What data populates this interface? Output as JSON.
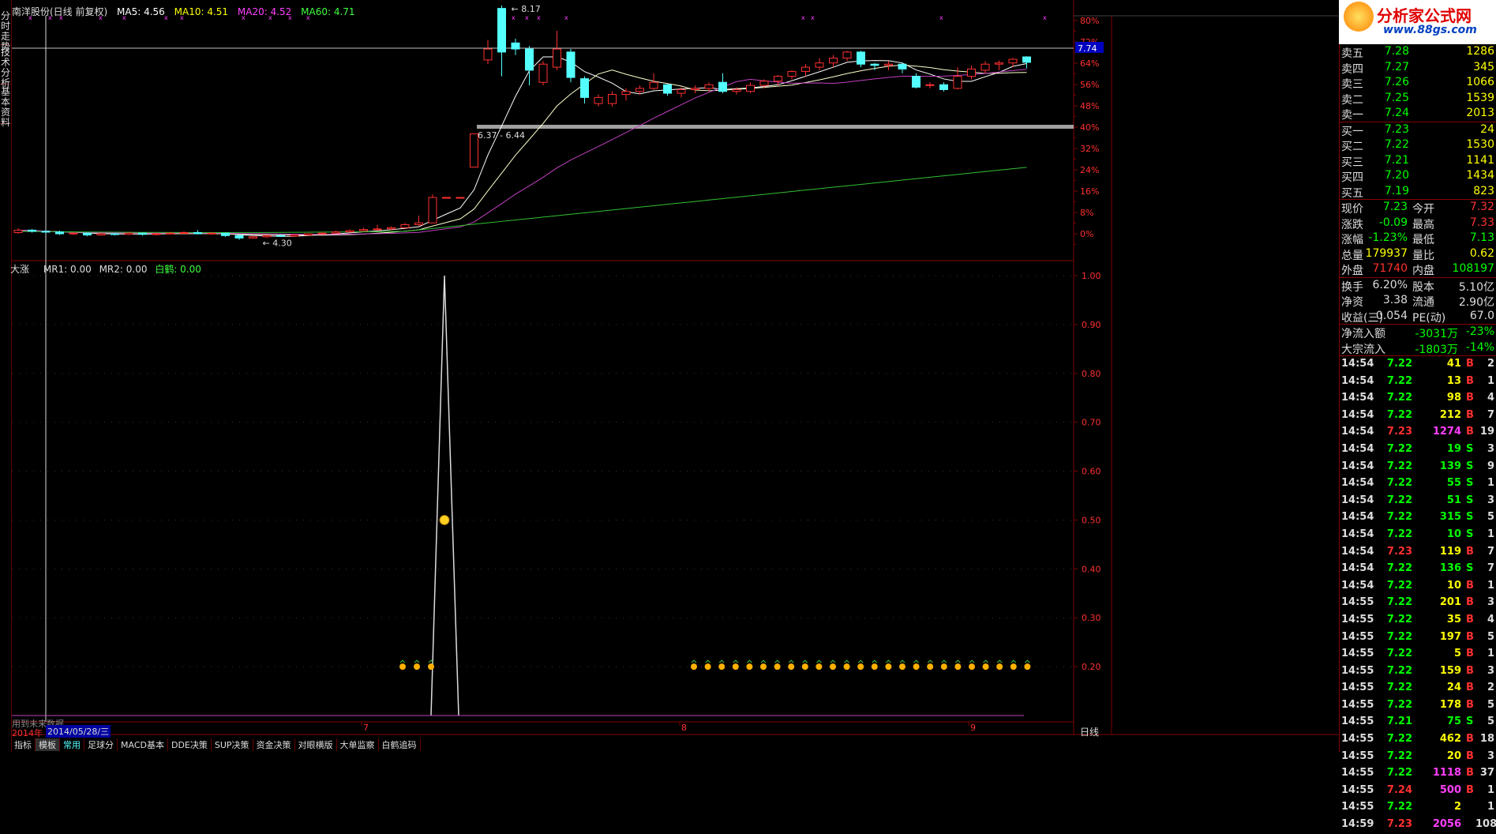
{
  "sidebar": {
    "tabs": [
      "分时走势",
      "技术分析",
      "基本资料"
    ]
  },
  "header": {
    "stock_name": "南洋股份(日线 前复权)",
    "ma5": "MA5: 4.56",
    "ma10": "MA10: 4.51",
    "ma20": "MA20: 4.52",
    "ma60": "MA60: 4.71",
    "colors": {
      "ma5": "#ffffff",
      "ma10": "#ffff00",
      "ma20": "#ff00ff",
      "ma60": "#00ff00"
    }
  },
  "price_chart": {
    "pct_ticks": [
      "80%",
      "72%",
      "64%",
      "56%",
      "48%",
      "40%",
      "32%",
      "24%",
      "16%",
      "8%",
      "0%"
    ],
    "current_price_tag": "7.74",
    "high_label": "8.17",
    "low_label": "4.30",
    "range_label": "6.37 - 6.44",
    "candles": [
      {
        "o": 4.42,
        "c": 4.46,
        "h": 4.49,
        "l": 4.4
      },
      {
        "o": 4.46,
        "c": 4.44,
        "h": 4.48,
        "l": 4.42
      },
      {
        "o": 4.44,
        "c": 4.43,
        "h": 4.46,
        "l": 4.41
      },
      {
        "o": 4.43,
        "c": 4.4,
        "h": 4.45,
        "l": 4.38
      },
      {
        "o": 4.4,
        "c": 4.41,
        "h": 4.43,
        "l": 4.38
      },
      {
        "o": 4.41,
        "c": 4.38,
        "h": 4.42,
        "l": 4.36
      },
      {
        "o": 4.38,
        "c": 4.4,
        "h": 4.42,
        "l": 4.37
      },
      {
        "o": 4.4,
        "c": 4.39,
        "h": 4.41,
        "l": 4.37
      },
      {
        "o": 4.39,
        "c": 4.41,
        "h": 4.43,
        "l": 4.38
      },
      {
        "o": 4.41,
        "c": 4.39,
        "h": 4.42,
        "l": 4.37
      },
      {
        "o": 4.39,
        "c": 4.4,
        "h": 4.42,
        "l": 4.37
      },
      {
        "o": 4.4,
        "c": 4.41,
        "h": 4.43,
        "l": 4.39
      },
      {
        "o": 4.41,
        "c": 4.42,
        "h": 4.44,
        "l": 4.4
      },
      {
        "o": 4.42,
        "c": 4.4,
        "h": 4.46,
        "l": 4.39
      },
      {
        "o": 4.4,
        "c": 4.41,
        "h": 4.43,
        "l": 4.38
      },
      {
        "o": 4.41,
        "c": 4.37,
        "h": 4.42,
        "l": 4.35
      },
      {
        "o": 4.37,
        "c": 4.33,
        "h": 4.38,
        "l": 4.3
      },
      {
        "o": 4.33,
        "c": 4.35,
        "h": 4.36,
        "l": 4.32
      },
      {
        "o": 4.35,
        "c": 4.37,
        "h": 4.38,
        "l": 4.33
      },
      {
        "o": 4.37,
        "c": 4.36,
        "h": 4.39,
        "l": 4.35
      },
      {
        "o": 4.36,
        "c": 4.38,
        "h": 4.4,
        "l": 4.35
      },
      {
        "o": 4.38,
        "c": 4.4,
        "h": 4.41,
        "l": 4.36
      },
      {
        "o": 4.4,
        "c": 4.41,
        "h": 4.43,
        "l": 4.39
      },
      {
        "o": 4.41,
        "c": 4.43,
        "h": 4.45,
        "l": 4.4
      },
      {
        "o": 4.43,
        "c": 4.45,
        "h": 4.47,
        "l": 4.42
      },
      {
        "o": 4.45,
        "c": 4.47,
        "h": 4.5,
        "l": 4.44
      },
      {
        "o": 4.47,
        "c": 4.48,
        "h": 4.55,
        "l": 4.46
      },
      {
        "o": 4.48,
        "c": 4.5,
        "h": 4.52,
        "l": 4.46
      },
      {
        "o": 4.5,
        "c": 4.55,
        "h": 4.58,
        "l": 4.49
      },
      {
        "o": 4.55,
        "c": 4.58,
        "h": 4.7,
        "l": 4.53
      },
      {
        "o": 4.58,
        "c": 5.0,
        "h": 5.05,
        "l": 4.58
      },
      {
        "o": 5.0,
        "c": 5.0,
        "h": 5.0,
        "l": 5.0
      },
      {
        "o": 5.0,
        "c": 5.0,
        "h": 5.5,
        "l": 5.5
      },
      {
        "o": 5.5,
        "c": 6.05,
        "h": 6.05,
        "l": 6.05
      },
      {
        "o": 7.27,
        "c": 7.45,
        "h": 7.6,
        "l": 7.2
      },
      {
        "o": 8.12,
        "c": 7.4,
        "h": 8.17,
        "l": 7.0
      },
      {
        "o": 7.55,
        "c": 7.45,
        "h": 7.62,
        "l": 7.35
      },
      {
        "o": 7.45,
        "c": 7.1,
        "h": 7.5,
        "l": 6.85
      },
      {
        "o": 6.9,
        "c": 7.2,
        "h": 7.25,
        "l": 6.85
      },
      {
        "o": 7.15,
        "c": 7.45,
        "h": 7.75,
        "l": 7.1
      },
      {
        "o": 7.4,
        "c": 6.98,
        "h": 7.45,
        "l": 6.9
      },
      {
        "o": 6.96,
        "c": 6.65,
        "h": 7.0,
        "l": 6.55
      },
      {
        "o": 6.55,
        "c": 6.65,
        "h": 6.7,
        "l": 6.5
      },
      {
        "o": 6.55,
        "c": 6.7,
        "h": 6.75,
        "l": 6.5
      },
      {
        "o": 6.7,
        "c": 6.75,
        "h": 6.8,
        "l": 6.6
      },
      {
        "o": 6.75,
        "c": 6.8,
        "h": 6.85,
        "l": 6.7
      },
      {
        "o": 6.8,
        "c": 6.9,
        "h": 7.05,
        "l": 6.78
      },
      {
        "o": 6.86,
        "c": 6.72,
        "h": 6.88,
        "l": 6.68
      },
      {
        "o": 6.72,
        "c": 6.78,
        "h": 6.82,
        "l": 6.65
      },
      {
        "o": 6.78,
        "c": 6.8,
        "h": 6.85,
        "l": 6.72
      },
      {
        "o": 6.8,
        "c": 6.86,
        "h": 6.9,
        "l": 6.75
      },
      {
        "o": 6.9,
        "c": 6.75,
        "h": 7.05,
        "l": 6.72
      },
      {
        "o": 6.75,
        "c": 6.78,
        "h": 6.82,
        "l": 6.7
      },
      {
        "o": 6.75,
        "c": 6.85,
        "h": 6.9,
        "l": 6.72
      },
      {
        "o": 6.85,
        "c": 6.92,
        "h": 6.95,
        "l": 6.8
      },
      {
        "o": 6.92,
        "c": 7.0,
        "h": 7.02,
        "l": 6.85
      },
      {
        "o": 7.0,
        "c": 7.08,
        "h": 7.1,
        "l": 6.95
      },
      {
        "o": 7.08,
        "c": 7.15,
        "h": 7.2,
        "l": 7.0
      },
      {
        "o": 7.15,
        "c": 7.22,
        "h": 7.3,
        "l": 7.1
      },
      {
        "o": 7.22,
        "c": 7.3,
        "h": 7.35,
        "l": 7.15
      },
      {
        "o": 7.3,
        "c": 7.4,
        "h": 7.42,
        "l": 7.25
      },
      {
        "o": 7.4,
        "c": 7.2,
        "h": 7.42,
        "l": 7.15
      },
      {
        "o": 7.2,
        "c": 7.18,
        "h": 7.22,
        "l": 7.1
      },
      {
        "o": 7.18,
        "c": 7.2,
        "h": 7.25,
        "l": 7.1
      },
      {
        "o": 7.2,
        "c": 7.12,
        "h": 7.22,
        "l": 7.05
      },
      {
        "o": 7.0,
        "c": 6.82,
        "h": 7.05,
        "l": 6.8
      },
      {
        "o": 6.85,
        "c": 6.86,
        "h": 6.9,
        "l": 6.8
      },
      {
        "o": 6.86,
        "c": 6.78,
        "h": 6.9,
        "l": 6.75
      },
      {
        "o": 6.8,
        "c": 7.0,
        "h": 7.15,
        "l": 6.78
      },
      {
        "o": 7.0,
        "c": 7.12,
        "h": 7.18,
        "l": 6.95
      },
      {
        "o": 7.1,
        "c": 7.2,
        "h": 7.25,
        "l": 7.05
      },
      {
        "o": 7.2,
        "c": 7.22,
        "h": 7.26,
        "l": 7.1
      },
      {
        "o": 7.22,
        "c": 7.28,
        "h": 7.3,
        "l": 7.15
      },
      {
        "o": 7.32,
        "c": 7.23,
        "h": 7.33,
        "l": 7.13
      }
    ]
  },
  "indicator": {
    "name": "大涨",
    "mr1": "MR1: 0.00",
    "mr2": "MR2: 0.00",
    "baihe": "白鹤: 0.00",
    "ticks": [
      "1.00",
      "0.90",
      "0.80",
      "0.70",
      "0.60",
      "0.50",
      "0.40",
      "0.30",
      "0.20"
    ],
    "note": "用到未来数据"
  },
  "timeline": {
    "year": "2014年",
    "date": "2014/05/28/三",
    "months": [
      "7",
      "8",
      "9"
    ],
    "period": "日线"
  },
  "bottom_tabs": [
    "指标",
    "模板",
    "常用",
    "足球分",
    "MACD基本",
    "DDE决策",
    "SUP决策",
    "资金决策",
    "对眼横版",
    "大单监察",
    "白鹤追码"
  ],
  "quote": {
    "sell": [
      {
        "label": "卖五",
        "price": "7.28",
        "vol": "1286"
      },
      {
        "label": "卖四",
        "price": "7.27",
        "vol": "345"
      },
      {
        "label": "卖三",
        "price": "7.26",
        "vol": "1066"
      },
      {
        "label": "卖二",
        "price": "7.25",
        "vol": "1539"
      },
      {
        "label": "卖一",
        "price": "7.24",
        "vol": "2013"
      }
    ],
    "buy": [
      {
        "label": "买一",
        "price": "7.23",
        "vol": "24"
      },
      {
        "label": "买二",
        "price": "7.22",
        "vol": "1530"
      },
      {
        "label": "买三",
        "price": "7.21",
        "vol": "1141"
      },
      {
        "label": "买四",
        "price": "7.20",
        "vol": "1434"
      },
      {
        "label": "买五",
        "price": "7.19",
        "vol": "823"
      }
    ],
    "stats": [
      {
        "l1": "现价",
        "v1": "7.23",
        "c1": "#00ff00",
        "l2": "今开",
        "v2": "7.32",
        "c2": "#ff3030"
      },
      {
        "l1": "涨跌",
        "v1": "-0.09",
        "c1": "#00ff00",
        "l2": "最高",
        "v2": "7.33",
        "c2": "#ff3030"
      },
      {
        "l1": "涨幅",
        "v1": "-1.23%",
        "c1": "#00ff00",
        "l2": "最低",
        "v2": "7.13",
        "c2": "#00ff00"
      },
      {
        "l1": "总量",
        "v1": "179937",
        "c1": "#ffff00",
        "l2": "量比",
        "v2": "0.62",
        "c2": "#ffff00"
      },
      {
        "l1": "外盘",
        "v1": "71740",
        "c1": "#ff3030",
        "l2": "内盘",
        "v2": "108197",
        "c2": "#00ff00"
      }
    ],
    "fund": [
      {
        "l1": "换手",
        "v1": "6.20%",
        "l2": "股本",
        "v2": "5.10亿"
      },
      {
        "l1": "净资",
        "v1": "3.38",
        "l2": "流通",
        "v2": "2.90亿"
      },
      {
        "l1": "收益(三)",
        "v1": "0.054",
        "l2": "PE(动)",
        "v2": "67.0"
      }
    ],
    "flow": [
      {
        "label": "净流入额",
        "v1": "-3031万",
        "v2": "-23%"
      },
      {
        "label": "大宗流入",
        "v1": "-1803万",
        "v2": "-14%"
      }
    ]
  },
  "ticks_list": [
    {
      "t": "14:54",
      "p": "7.22",
      "v": "41",
      "s": "B",
      "n": "2"
    },
    {
      "t": "14:54",
      "p": "7.22",
      "v": "13",
      "s": "B",
      "n": "1"
    },
    {
      "t": "14:54",
      "p": "7.22",
      "v": "98",
      "s": "B",
      "n": "4"
    },
    {
      "t": "14:54",
      "p": "7.22",
      "v": "212",
      "s": "B",
      "n": "7"
    },
    {
      "t": "14:54",
      "p": "7.23",
      "v": "1274",
      "s": "B",
      "n": "19"
    },
    {
      "t": "14:54",
      "p": "7.22",
      "v": "19",
      "s": "S",
      "n": "3"
    },
    {
      "t": "14:54",
      "p": "7.22",
      "v": "139",
      "s": "S",
      "n": "9"
    },
    {
      "t": "14:54",
      "p": "7.22",
      "v": "55",
      "s": "S",
      "n": "1"
    },
    {
      "t": "14:54",
      "p": "7.22",
      "v": "51",
      "s": "S",
      "n": "3"
    },
    {
      "t": "14:54",
      "p": "7.22",
      "v": "315",
      "s": "S",
      "n": "5"
    },
    {
      "t": "14:54",
      "p": "7.22",
      "v": "10",
      "s": "S",
      "n": "1"
    },
    {
      "t": "14:54",
      "p": "7.23",
      "v": "119",
      "s": "B",
      "n": "7"
    },
    {
      "t": "14:54",
      "p": "7.22",
      "v": "136",
      "s": "S",
      "n": "7"
    },
    {
      "t": "14:54",
      "p": "7.22",
      "v": "10",
      "s": "B",
      "n": "1"
    },
    {
      "t": "14:55",
      "p": "7.22",
      "v": "201",
      "s": "B",
      "n": "3"
    },
    {
      "t": "14:55",
      "p": "7.22",
      "v": "35",
      "s": "B",
      "n": "4"
    },
    {
      "t": "14:55",
      "p": "7.22",
      "v": "197",
      "s": "B",
      "n": "5"
    },
    {
      "t": "14:55",
      "p": "7.22",
      "v": "5",
      "s": "B",
      "n": "1"
    },
    {
      "t": "14:55",
      "p": "7.22",
      "v": "159",
      "s": "B",
      "n": "3"
    },
    {
      "t": "14:55",
      "p": "7.22",
      "v": "24",
      "s": "B",
      "n": "2"
    },
    {
      "t": "14:55",
      "p": "7.22",
      "v": "178",
      "s": "B",
      "n": "5"
    },
    {
      "t": "14:55",
      "p": "7.21",
      "v": "75",
      "s": "S",
      "n": "5"
    },
    {
      "t": "14:55",
      "p": "7.22",
      "v": "462",
      "s": "B",
      "n": "18"
    },
    {
      "t": "14:55",
      "p": "7.22",
      "v": "20",
      "s": "B",
      "n": "3"
    },
    {
      "t": "14:55",
      "p": "7.22",
      "v": "1118",
      "s": "B",
      "n": "37"
    },
    {
      "t": "14:55",
      "p": "7.24",
      "v": "500",
      "s": "B",
      "n": "1"
    },
    {
      "t": "14:55",
      "p": "7.22",
      "v": "2",
      "s": "",
      "n": "1"
    },
    {
      "t": "14:59",
      "p": "7.23",
      "v": "2056",
      "s": "",
      "n": "108"
    }
  ],
  "logo": {
    "text": "分析家公式网",
    "url_text": "www.88gs.com"
  },
  "colors": {
    "up": "#ff3030",
    "down": "#54ffff",
    "grid": "#800000",
    "label_red": "#ff3030",
    "purple": "#c040c0"
  }
}
